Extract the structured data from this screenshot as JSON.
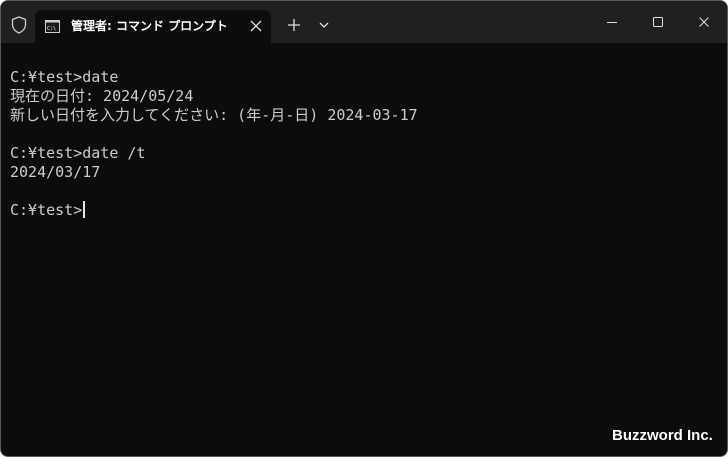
{
  "titlebar": {
    "tab_title": "管理者: コマンド プロンプト",
    "icons": {
      "shield": "shield-icon",
      "tab": "command-prompt-icon",
      "close_tab": "close-icon",
      "new_tab": "plus-icon",
      "dropdown": "chevron-down-icon",
      "minimize": "minimize-icon",
      "maximize": "maximize-icon",
      "close_window": "close-icon"
    }
  },
  "terminal": {
    "lines": [
      "",
      "C:¥test>date",
      "現在の日付: 2024/05/24",
      "新しい日付を入力してください: (年-月-日) 2024-03-17",
      "",
      "C:¥test>date /t",
      "2024/03/17",
      "",
      "C:¥test>"
    ]
  },
  "watermark": "Buzzword Inc.",
  "colors": {
    "titlebar_bg": "#202020",
    "terminal_bg": "#0c0c0c",
    "text": "#cccccc"
  }
}
